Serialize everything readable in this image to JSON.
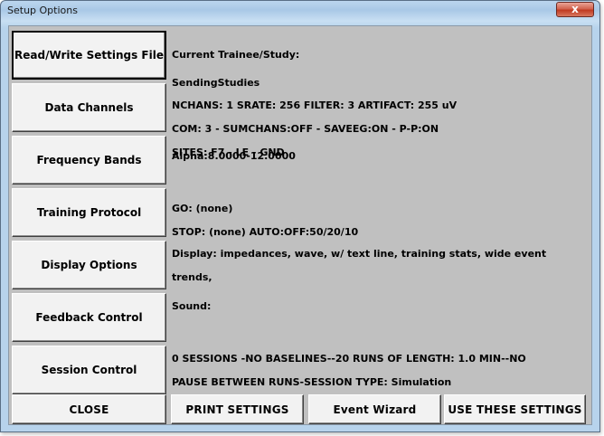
{
  "window": {
    "title": "Setup Options",
    "close_glyph": "x"
  },
  "rows": [
    {
      "button": "Read/Write Settings File",
      "lines": [
        "Current Trainee/Study:",
        "SendingStudies"
      ]
    },
    {
      "button": "Data Channels",
      "lines": [
        "NCHANS: 1   SRATE: 256   FILTER: 3  ARTIFACT: 255 uV",
        "COM: 3 - SUMCHANS:OFF - SAVEEG:ON - P-P:ON",
        "SITES:  F7 - LE - GND"
      ]
    },
    {
      "button": "Frequency Bands",
      "lines": [
        "Alpha:8.0000-12.0000"
      ]
    },
    {
      "button": "Training Protocol",
      "lines": [
        "GO:  (none)",
        "STOP: (none) AUTO:OFF:50/20/10"
      ]
    },
    {
      "button": "Display Options",
      "lines": [
        "Display: impedances, wave, w/ text line, training stats, wide event",
        "trends,"
      ]
    },
    {
      "button": "Feedback Control",
      "lines": [
        "Sound:"
      ]
    },
    {
      "button": "Session Control",
      "lines": [
        "0 SESSIONS -NO BASELINES--20 RUNS OF LENGTH: 1.0 MIN--NO",
        "PAUSE BETWEEN RUNS-SESSION TYPE: Simulation"
      ]
    }
  ],
  "bottom_buttons": {
    "close": "CLOSE",
    "print": "PRINT SETTINGS",
    "wizard": "Event Wizard",
    "use": "USE THESE SETTINGS"
  }
}
